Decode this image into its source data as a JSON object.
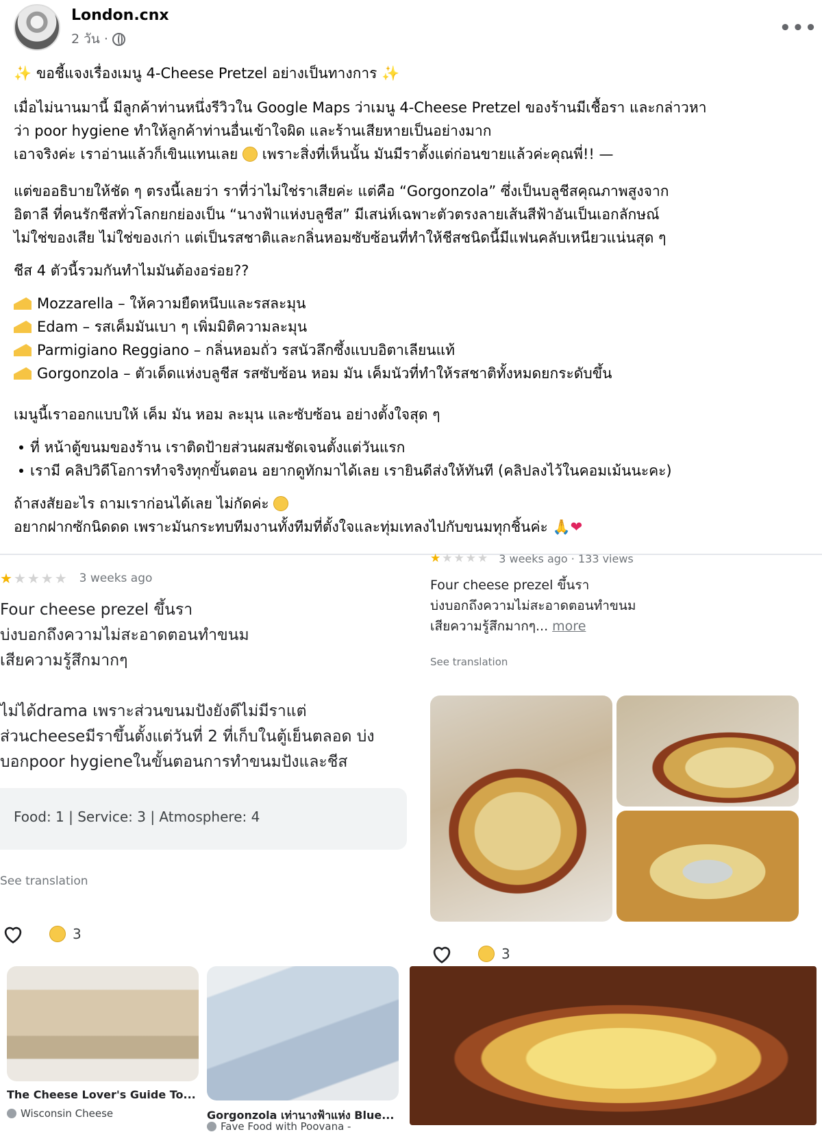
{
  "post": {
    "author": "London.cnx",
    "time": "2 วัน ·",
    "title": "ขอชี้แจงเรื่องเมนู 4-Cheese Pretzel อย่างเป็นทางการ",
    "p1_l1": "เมื่อไม่นานมานี้ มีลูกค้าท่านหนึ่งรีวิวใน Google Maps ว่าเมนู 4-Cheese Pretzel ของร้านมีเชื้อรา และกล่าวหา",
    "p1_l2": "ว่า poor hygiene ทำให้ลูกค้าท่านอื่นเข้าใจผิด และร้านเสียหายเป็นอย่างมาก",
    "p1_l3a": "เอาจริงค่ะ เราอ่านแล้วก็เขินแทนเลย",
    "p1_l3b": "เพราะสิ่งที่เห็นนั้น มันมีราตั้งแต่ก่อนขายแล้วค่ะคุณพี่!! —",
    "p2_l1": "แต่ขออธิบายให้ชัด ๆ ตรงนี้เลยว่า ราที่ว่าไม่ใช่ราเสียค่ะ แต่คือ “Gorgonzola” ซึ่งเป็นบลูชีสคุณภาพสูงจาก",
    "p2_l2": "อิตาลี ที่คนรักชีสทั่วโลกยกย่องเป็น “นางฟ้าแห่งบลูชีส” มีเสน่ห์เฉพาะตัวตรงลายเส้นสีฟ้าอันเป็นเอกลักษณ์",
    "p2_l3": "ไม่ใช่ของเสีย ไม่ใช่ของเก่า แต่เป็นรสชาติและกลิ่นหอมซับซ้อนที่ทำให้ชีสชนิดนี้มีแฟนคลับเหนียวแน่นสุด ๆ",
    "question": "ชีส 4 ตัวนี้รวมกันทำไมมันต้องอร่อย??",
    "cheeses": [
      "Mozzarella – ให้ความยืดหนึบและรสละมุน",
      "Edam – รสเค็มมันเบา ๆ เพิ่มมิติความละมุน",
      "Parmigiano Reggiano – กลิ่นหอมถั่ว รสนัวลึกซึ้งแบบอิตาเลียนแท้",
      "Gorgonzola – ตัวเด็ดแห่งบลูชีส รสซับซ้อน หอม มัน เค็มนัวที่ทำให้รสชาติทั้งหมดยกระดับขึ้น"
    ],
    "design": "เมนูนี้เราออกแบบให้ เค็ม มัน หอม ละมุน และซับซ้อน อย่างตั้งใจสุด ๆ",
    "bullets": [
      "ที่ หน้าตู้ขนมของร้าน เราติดป้ายส่วนผสมชัดเจนตั้งแต่วันแรก",
      "เรามี คลิปวิดีโอการทำจริงทุกขั้นตอน อยากดูทักมาได้เลย เรายินดีส่งให้ทันที (คลิปลงไว้ในคอมเม้นนะคะ)"
    ],
    "closing_l1": "ถ้าสงสัยอะไร ถามเราก่อนได้เลย ไม่กัดค่ะ",
    "closing_l2": "อยากฝากซักนิดดด เพราะมันกระทบทีมงานทั้งทีมที่ตั้งใจและทุ่มเทลงไปกับขนมทุกชิ้นค่ะ"
  },
  "review_left": {
    "rating": 1,
    "time": "3 weeks ago",
    "lines": [
      "Four cheese prezel ขึ้นรา",
      "บ่งบอกถึงความไม่สะอาดตอนทำขนม",
      "เสียความรู้สึกมากๆ",
      "",
      "ไม่ได้drama เพราะส่วนขนมปังยังดีไม่มีราแต่",
      "ส่วนcheeseมีราขึ้นตั้งแต่วันที่ 2 ที่เก็บในตู้เย็นตลอด บ่ง",
      "บอกpoor hygieneในขั้นตอนการทำขนมปังและชีส"
    ],
    "scores": "Food: 1  |  Service: 3  |  Atmosphere: 4",
    "see_translation": "See translation",
    "reaction_count": "3"
  },
  "review_right": {
    "rating": 1,
    "time": "3 weeks ago · 133 views",
    "lines": [
      "Four cheese prezel ขึ้นรา",
      "บ่งบอกถึงความไม่สะอาดตอนทำขนม",
      "เสียความรู้สึกมากๆ..."
    ],
    "more": "more",
    "see_translation": "See translation",
    "reaction_count": "3"
  },
  "thumbs": [
    {
      "title": "The Cheese Lover's Guide To...",
      "source": "Wisconsin Cheese"
    },
    {
      "title": "Gorgonzola เท่านางฟ้าแห่ง Blue...",
      "source": "Fave Food with Poovana -"
    }
  ],
  "colors": {
    "star": "#f5b400",
    "heart": "#e0245e",
    "muted": "#65676b"
  }
}
